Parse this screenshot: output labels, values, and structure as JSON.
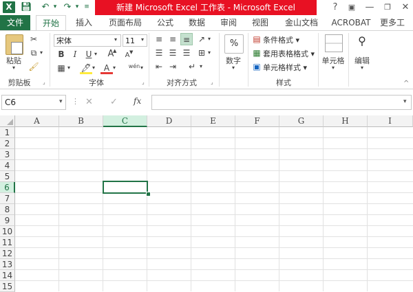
{
  "title_bar": {
    "app_logo": "X",
    "title": "新建 Microsoft Excel 工作表 - Microsoft Excel",
    "qat_icons": [
      "save-icon",
      "undo-icon",
      "redo-icon"
    ],
    "window_buttons": [
      "?",
      "▢",
      "—",
      "▭",
      "✕"
    ]
  },
  "tabs": {
    "file": "文件",
    "items": [
      "开始",
      "插入",
      "页面布局",
      "公式",
      "数据",
      "审阅",
      "视图",
      "金山文档",
      "ACROBAT",
      "更多工"
    ]
  },
  "ribbon": {
    "clipboard": {
      "label": "剪贴板",
      "paste": "粘贴"
    },
    "font": {
      "label": "字体",
      "font_name": "宋体",
      "font_size": "11",
      "bold": "B",
      "italic": "I",
      "underline": "U",
      "grow": "A",
      "shrink": "A",
      "wen": "wén"
    },
    "align": {
      "label": "对齐方式"
    },
    "number": {
      "label": "数字",
      "icon": "%"
    },
    "styles": {
      "label": "样式",
      "conditional": "条件格式",
      "table": "套用表格格式",
      "cell_style": "单元格样式"
    },
    "cells": {
      "label": "单元格"
    },
    "editing": {
      "label": "编辑"
    }
  },
  "formula_bar": {
    "name_box": "C6",
    "fx": "fx",
    "cancel": "✕",
    "enter": "✓",
    "value": ""
  },
  "sheet": {
    "columns": [
      "A",
      "B",
      "C",
      "D",
      "E",
      "F",
      "G",
      "H",
      "I"
    ],
    "rows": [
      "1",
      "2",
      "3",
      "4",
      "5",
      "6",
      "7",
      "8",
      "9",
      "10",
      "11",
      "12",
      "13",
      "14",
      "15"
    ],
    "selected_cell": "C6",
    "accent": "#217346",
    "selected_header_bg": "#a0d2b5"
  }
}
